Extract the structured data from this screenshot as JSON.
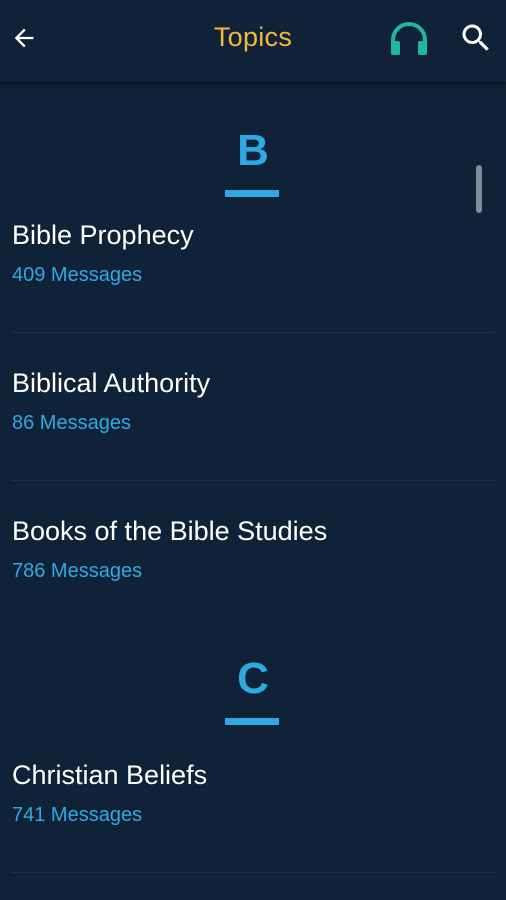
{
  "appbar": {
    "title": "Topics",
    "back_icon": "arrow-left-icon",
    "audio_icon": "headphones-icon",
    "search_icon": "search-icon",
    "title_color": "#f2b93d",
    "audio_color": "#1fb5a8"
  },
  "sections": [
    {
      "letter": "B",
      "topics": [
        {
          "name": "Bible Prophecy",
          "count": "409 Messages"
        },
        {
          "name": "Biblical Authority",
          "count": "86 Messages"
        },
        {
          "name": "Books of the Bible Studies",
          "count": "786 Messages"
        }
      ]
    },
    {
      "letter": "C",
      "topics": [
        {
          "name": "Christian Beliefs",
          "count": "741 Messages"
        }
      ]
    }
  ],
  "colors": {
    "background": "#0f2238",
    "accent": "#2fa9e2",
    "text": "#ffffff"
  }
}
